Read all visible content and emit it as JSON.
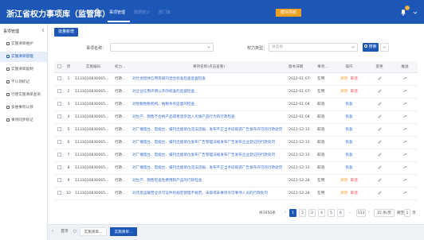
{
  "header": {
    "title": "浙江省权力事项库（监管库）",
    "nav": [
      "事项管理",
      "数据统计",
      "部门库"
    ],
    "action_button": "模块导航",
    "notification_count": "15"
  },
  "sidebar": {
    "title": "事项管理",
    "items": [
      {
        "label": "实施清单维护"
      },
      {
        "label": "实施清单管理"
      },
      {
        "label": "实施清单复制"
      },
      {
        "label": "不认领标记"
      },
      {
        "label": "行使实施清单查询"
      },
      {
        "label": "多维事项认领"
      },
      {
        "label": "事项同步标记"
      }
    ]
  },
  "toolbar": {
    "new_button": "批量新增"
  },
  "filters": {
    "matter_name_label": "事项名称：",
    "power_type_label": "权力类型：",
    "power_type_placeholder": "请选择",
    "search_button": "搜索"
  },
  "table": {
    "headers": [
      "",
      "序",
      "实施编码",
      "权力...",
      "事项名称(点击查看)",
      "版本日期",
      "事项...",
      "操作",
      "变更",
      "推送"
    ],
    "rows": [
      {
        "no": "1",
        "code": "1133010836665...",
        "type": "行政...",
        "name": "对社会团体信用等级的混合标准检查监督检查",
        "date": "2022-01-07",
        "status": "在用",
        "op": "edit-cancel"
      },
      {
        "no": "2",
        "code": "1133010836665...",
        "type": "行政...",
        "name": "对企业信用声明公开的标准的监督检查",
        "date": "2022-01-07",
        "status": "在用",
        "op": "edit-cancel"
      },
      {
        "no": "3",
        "code": "1133010836665...",
        "type": "行政...",
        "name": "对地税地税机构、纳税条务监督的检查",
        "date": "2022-01-04",
        "status": "取消",
        "op": "restore"
      },
      {
        "no": "4",
        "code": "1133010836665...",
        "type": "行政...",
        "name": "对生产、销售不合格产品或者混杂混入劣质产品行为的行政检查",
        "date": "2022-01-04",
        "status": "取消",
        "op": "restore"
      },
      {
        "no": "5",
        "code": "1133010836665...",
        "type": "行政...",
        "name": "对广播电台、电视台、报刊出版单位违法违规、发布不正当手段取得广告发布许可的行政处罚",
        "date": "2021-12-31",
        "status": "取消",
        "op": "restore"
      },
      {
        "no": "6",
        "code": "1133010836665...",
        "type": "行政...",
        "name": "对广播电台、电视台、报刊出版单位发布广告管理法规发布广告发布企业登记的行政处罚",
        "date": "2021-12-31",
        "status": "取消",
        "op": "restore"
      },
      {
        "no": "7",
        "code": "1133010836665...",
        "type": "行政...",
        "name": "对广播电台、电视台、报刊出版单位发布广告管理法规发布广告发布企业登记的行政处罚",
        "date": "2021-12-31",
        "status": "取消",
        "op": "restore"
      },
      {
        "no": "8",
        "code": "1133010836665...",
        "type": "行政...",
        "name": "对广播电台、电视台、报刊出版单位违法违规、发布不正当手段取得广告发布许可的行政处罚",
        "date": "2021-12-31",
        "status": "取消",
        "op": "restore"
      },
      {
        "no": "9",
        "code": "1133010836665...",
        "type": "行政...",
        "name": "对生产、销售检查性费用和产品的行政检查",
        "date": "2021-12-28",
        "status": "在用",
        "op": "edit-cancel"
      },
      {
        "no": "10",
        "code": "1133010836665...",
        "type": "行政...",
        "name": "对违反运输营业许可证件的规定管理不规范，未取得未事项许可事项人员的行政处罚",
        "date": "2021-12-28",
        "status": "在用",
        "op": "edit-cancel"
      }
    ],
    "op_labels": {
      "edit": "修改",
      "cancel": "取消",
      "restore": "恢复"
    }
  },
  "pagination": {
    "total": "共1950条",
    "pages": [
      "1",
      "2",
      "3",
      "4",
      "5",
      "6",
      "...",
      "133"
    ],
    "page_size": "15 条/页",
    "goto_label": "跳至",
    "goto_value": "1",
    "goto_suffix": "页"
  },
  "bottom_tabs": {
    "home": "首页",
    "tabs": [
      "实施清单...",
      "实施清单..."
    ]
  },
  "colors": {
    "brand_blue": "#1c57b8",
    "accent_orange": "#f0a020",
    "cancel_red": "#e04a4a"
  }
}
